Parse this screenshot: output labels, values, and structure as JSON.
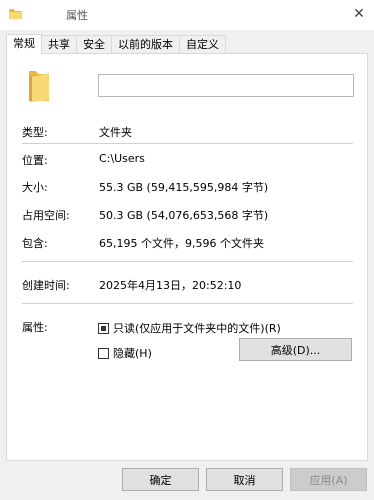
{
  "window": {
    "title": "属性",
    "close_glyph": "✕"
  },
  "tabs": [
    {
      "label": "常规",
      "active": true
    },
    {
      "label": "共享",
      "active": false
    },
    {
      "label": "安全",
      "active": false
    },
    {
      "label": "以前的版本",
      "active": false
    },
    {
      "label": "自定义",
      "active": false
    }
  ],
  "general": {
    "name_value": "",
    "type_label": "类型:",
    "type_value": "文件夹",
    "location_label": "位置:",
    "location_value": "C:\\Users",
    "size_label": "大小:",
    "size_value": "55.3 GB (59,415,595,984 字节)",
    "disk_label": "占用空间:",
    "disk_value": "50.3 GB (54,076,653,568 字节)",
    "contains_label": "包含:",
    "contains_value": "65,195 个文件，9,596 个文件夹",
    "created_label": "创建时间:",
    "created_value": "2025年4月13日，20:52:10",
    "attributes_label": "属性:",
    "readonly_label": "只读(仅应用于文件夹中的文件)(R)",
    "hidden_label": "隐藏(H)",
    "advanced_label": "高级(D)..."
  },
  "footer": {
    "ok_label": "确定",
    "cancel_label": "取消",
    "apply_label": "应用(A)"
  },
  "colors": {
    "folder_yellow": "#f8d775",
    "folder_dark": "#e8b84a"
  }
}
